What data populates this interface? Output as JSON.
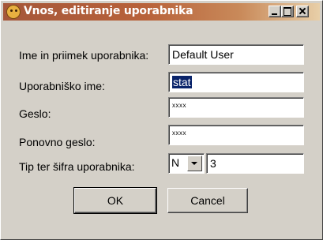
{
  "window": {
    "title": "Vnos, editiranje uporabnika",
    "icon": "user-face-icon"
  },
  "form": {
    "full_name": {
      "label": "Ime in priimek uporabnika:",
      "value": "Default User"
    },
    "username": {
      "label": "Uporabniško ime:",
      "value": "stat"
    },
    "password": {
      "label": "Geslo:",
      "value": "xxxx"
    },
    "password_repeat": {
      "label": "Ponovno geslo:",
      "value": "xxxx"
    },
    "user_type": {
      "label": "Tip ter šifra uporabnika:",
      "type_value": "N",
      "code_value": "3"
    }
  },
  "buttons": {
    "ok": "OK",
    "cancel": "Cancel"
  },
  "colors": {
    "title_bar": "#a5573a",
    "selection": "#0a246a",
    "face": "#d4d0c8"
  }
}
